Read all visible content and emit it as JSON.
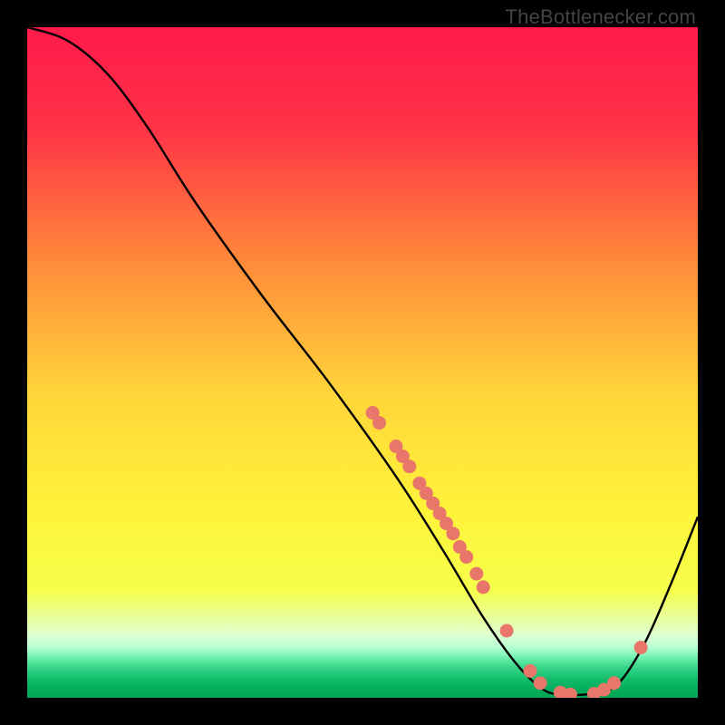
{
  "watermark": "TheBottlenecker.com",
  "chart_data": {
    "type": "line",
    "title": "",
    "xlabel": "",
    "ylabel": "",
    "xlim": [
      0,
      100
    ],
    "ylim": [
      0,
      100
    ],
    "curve": [
      {
        "x": 0,
        "y": 100
      },
      {
        "x": 6,
        "y": 98
      },
      {
        "x": 12,
        "y": 93
      },
      {
        "x": 18,
        "y": 85
      },
      {
        "x": 25,
        "y": 74
      },
      {
        "x": 35,
        "y": 60
      },
      {
        "x": 45,
        "y": 47
      },
      {
        "x": 55,
        "y": 33
      },
      {
        "x": 62,
        "y": 22
      },
      {
        "x": 68,
        "y": 12
      },
      {
        "x": 73,
        "y": 5
      },
      {
        "x": 77,
        "y": 1.2
      },
      {
        "x": 80,
        "y": 0.5
      },
      {
        "x": 84,
        "y": 0.6
      },
      {
        "x": 88,
        "y": 2
      },
      {
        "x": 92,
        "y": 8
      },
      {
        "x": 96,
        "y": 17
      },
      {
        "x": 100,
        "y": 27
      }
    ],
    "markers": [
      {
        "x": 51.5,
        "y": 42.5
      },
      {
        "x": 52.5,
        "y": 41.0
      },
      {
        "x": 55.0,
        "y": 37.5
      },
      {
        "x": 56.0,
        "y": 36.0
      },
      {
        "x": 57.0,
        "y": 34.5
      },
      {
        "x": 58.5,
        "y": 32.0
      },
      {
        "x": 59.5,
        "y": 30.5
      },
      {
        "x": 60.5,
        "y": 29.0
      },
      {
        "x": 61.5,
        "y": 27.5
      },
      {
        "x": 62.5,
        "y": 26.0
      },
      {
        "x": 63.5,
        "y": 24.5
      },
      {
        "x": 64.5,
        "y": 22.5
      },
      {
        "x": 65.5,
        "y": 21.0
      },
      {
        "x": 67.0,
        "y": 18.5
      },
      {
        "x": 68.0,
        "y": 16.5
      },
      {
        "x": 71.5,
        "y": 10.0
      },
      {
        "x": 75.0,
        "y": 4.0
      },
      {
        "x": 76.5,
        "y": 2.2
      },
      {
        "x": 79.5,
        "y": 0.8
      },
      {
        "x": 81.0,
        "y": 0.5
      },
      {
        "x": 84.5,
        "y": 0.6
      },
      {
        "x": 86.0,
        "y": 1.2
      },
      {
        "x": 87.5,
        "y": 2.2
      },
      {
        "x": 91.5,
        "y": 7.5
      }
    ],
    "marker_color": "#e8766a",
    "curve_color": "#000000",
    "gradient_stops": [
      {
        "offset": 0.0,
        "color": "#ff1a4a"
      },
      {
        "offset": 0.15,
        "color": "#ff3247"
      },
      {
        "offset": 0.35,
        "color": "#ff8a3a"
      },
      {
        "offset": 0.55,
        "color": "#ffd63a"
      },
      {
        "offset": 0.72,
        "color": "#fff33a"
      },
      {
        "offset": 0.84,
        "color": "#f6ff4a"
      },
      {
        "offset": 0.905,
        "color": "#dfffce"
      },
      {
        "offset": 0.918,
        "color": "#c8ffd6"
      },
      {
        "offset": 0.926,
        "color": "#b0ffd0"
      },
      {
        "offset": 0.934,
        "color": "#8ef8bf"
      },
      {
        "offset": 0.944,
        "color": "#5fe8a2"
      },
      {
        "offset": 0.955,
        "color": "#38d689"
      },
      {
        "offset": 0.965,
        "color": "#20c878"
      },
      {
        "offset": 0.975,
        "color": "#10b968"
      },
      {
        "offset": 0.985,
        "color": "#06ae5e"
      },
      {
        "offset": 1.0,
        "color": "#00a455"
      }
    ]
  }
}
